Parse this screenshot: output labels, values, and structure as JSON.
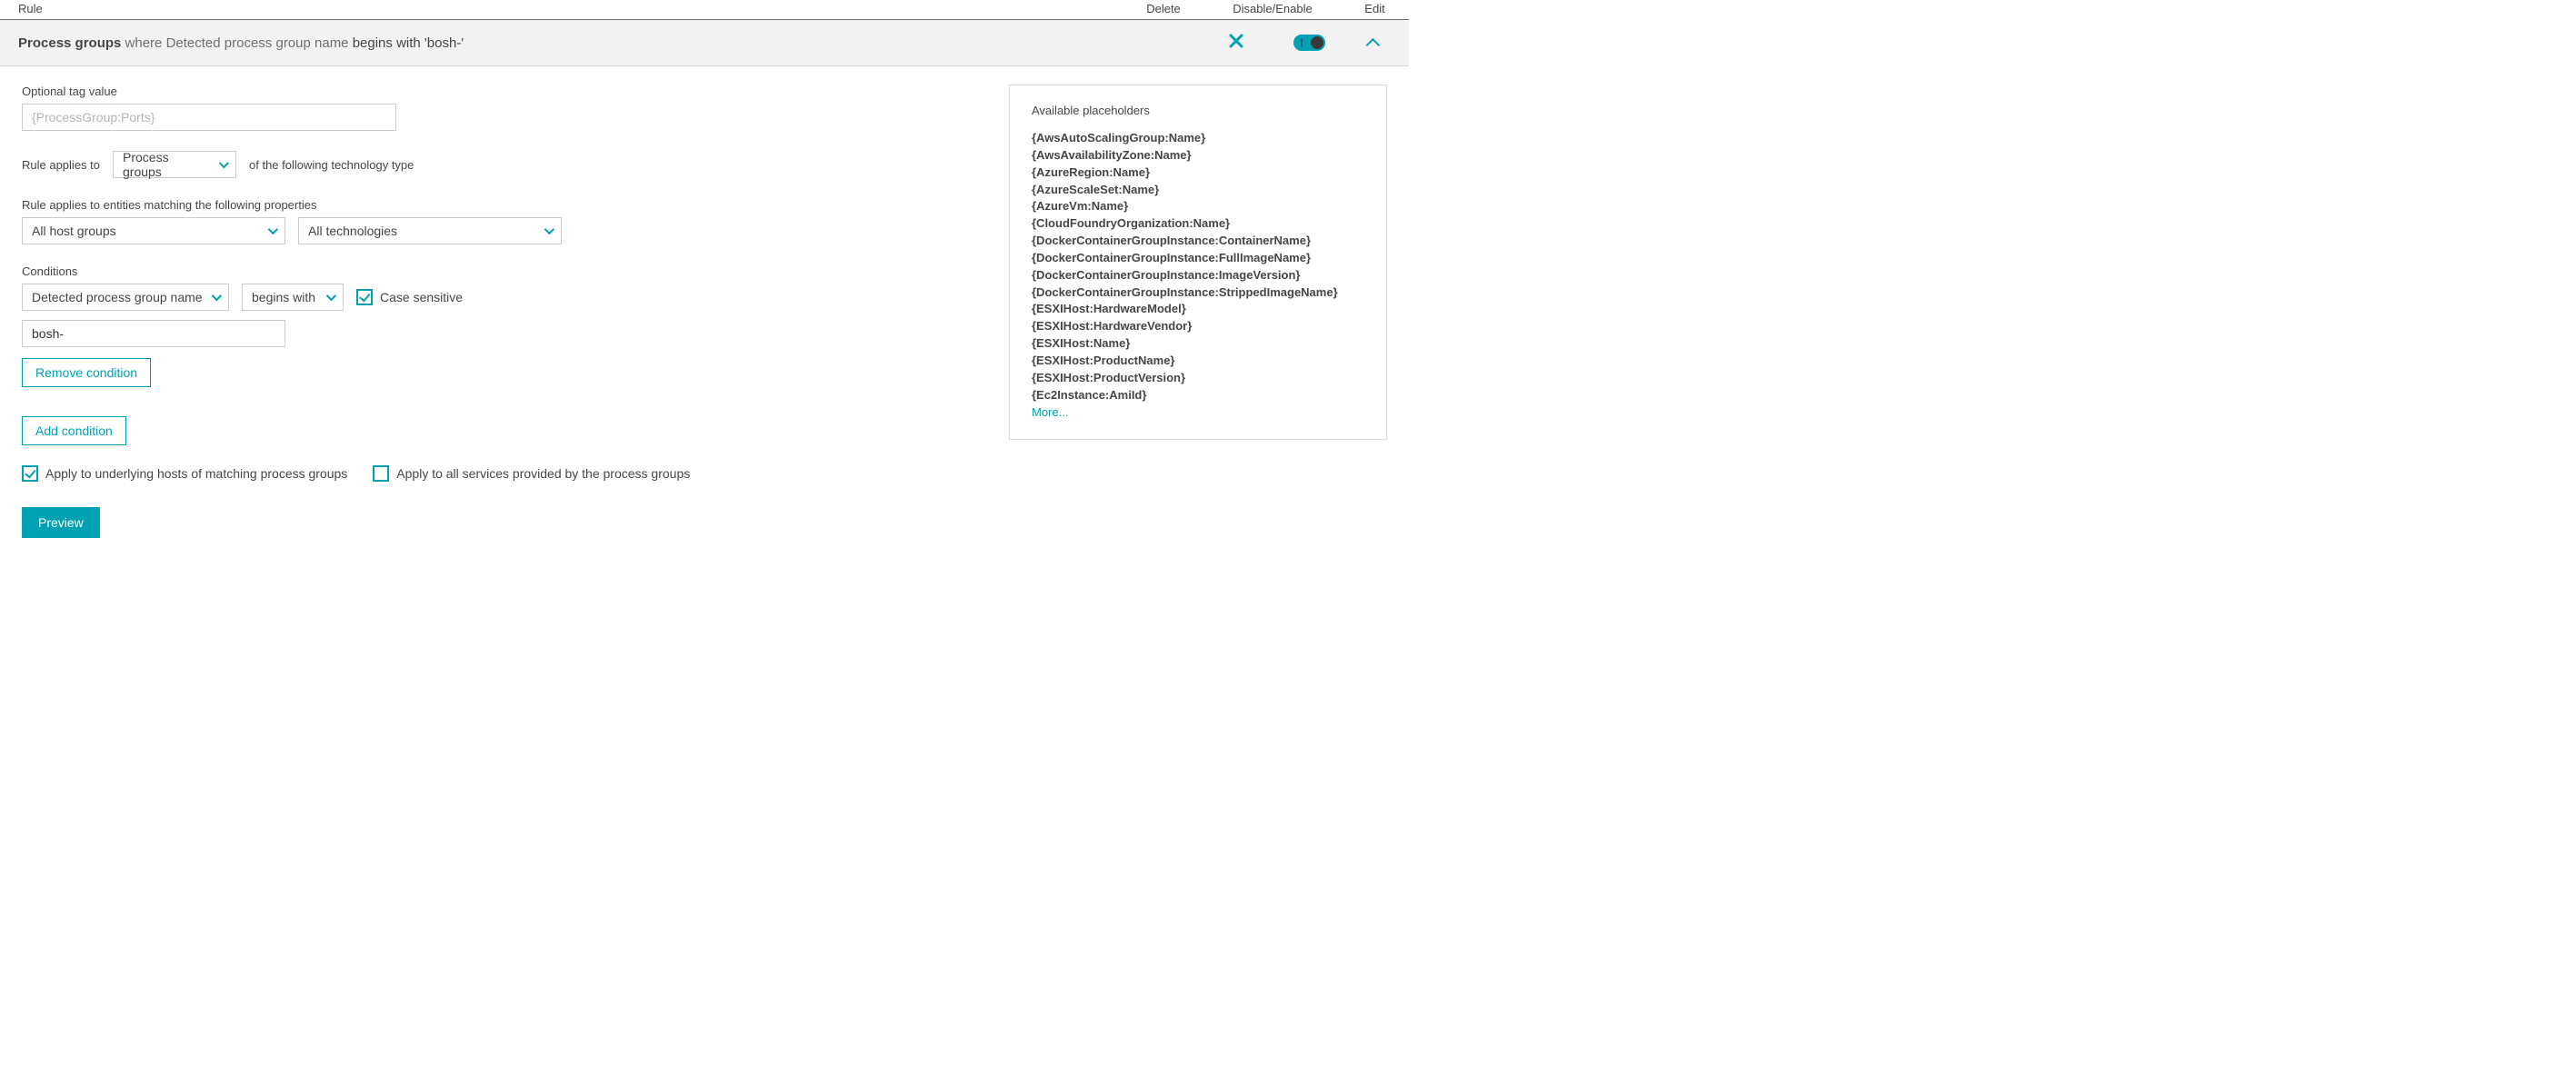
{
  "columns": {
    "rule": "Rule",
    "delete": "Delete",
    "toggle": "Disable/Enable",
    "edit": "Edit"
  },
  "ruleRow": {
    "prefix": "Process groups",
    "where": " where ",
    "italic": "Detected process group name",
    "middle": " begins with ",
    "suffix": "'bosh-'"
  },
  "form": {
    "optionalTagLabel": "Optional tag value",
    "optionalTagPlaceholder": "{ProcessGroup:Ports}",
    "appliesToLabel": "Rule applies to",
    "appliesToSelect": "Process groups",
    "ofTechText": "of the following technology type",
    "entitiesLabel": "Rule applies to entities matching the following properties",
    "hostGroupsSelect": "All host groups",
    "technologiesSelect": "All technologies",
    "conditionsLabel": "Conditions",
    "condAttr": "Detected process group name",
    "condOp": "begins with",
    "caseSensitive": "Case sensitive",
    "condValue": "bosh-",
    "removeCondition": "Remove condition",
    "addCondition": "Add condition",
    "applyHosts": "Apply to underlying hosts of matching process groups",
    "applyServices": "Apply to all services provided by the process groups",
    "preview": "Preview"
  },
  "side": {
    "title": "Available placeholders",
    "items": [
      "{AwsAutoScalingGroup:Name}",
      "{AwsAvailabilityZone:Name}",
      "{AzureRegion:Name}",
      "{AzureScaleSet:Name}",
      "{AzureVm:Name}",
      "{CloudFoundryOrganization:Name}",
      "{DockerContainerGroupInstance:ContainerName}",
      "{DockerContainerGroupInstance:FullImageName}",
      "{DockerContainerGroupInstance:ImageVersion}",
      "{DockerContainerGroupInstance:StrippedImageName}",
      "{ESXIHost:HardwareModel}",
      "{ESXIHost:HardwareVendor}",
      "{ESXIHost:Name}",
      "{ESXIHost:ProductName}",
      "{ESXIHost:ProductVersion}",
      "{Ec2Instance:AmiId}"
    ],
    "more": "More..."
  }
}
